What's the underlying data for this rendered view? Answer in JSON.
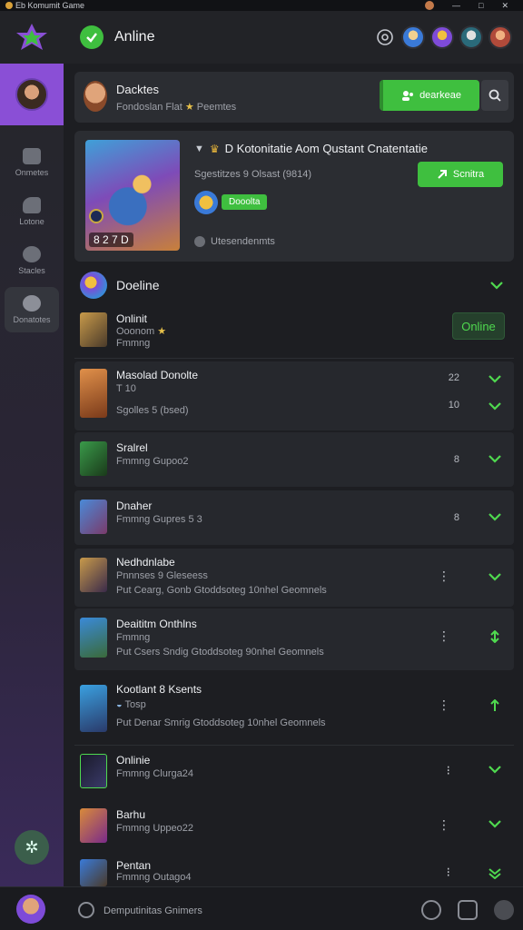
{
  "window": {
    "title": "Eb Komumit Game",
    "controls": [
      "—",
      "□",
      "✕"
    ]
  },
  "header": {
    "status_text": "Anline"
  },
  "sidebar": {
    "items": [
      {
        "label": "Onmetes",
        "icon": "store-icon"
      },
      {
        "label": "Lotone",
        "icon": "library-icon"
      },
      {
        "label": "Stacles",
        "icon": "friends-icon"
      },
      {
        "label": "Donatotes",
        "icon": "gear-icon"
      }
    ]
  },
  "profile": {
    "name": "Dacktes",
    "subtitle": "Fondoslan Flat",
    "status": "Peemtes",
    "add_button": "dearkeae"
  },
  "featured": {
    "title": "D Kotonitatie Aom Qustant Cnatentatie",
    "subtitle": "Sgestitzes 9 Olsast (9814)",
    "tag": "Dooolta",
    "button": "Scnitra",
    "version": "8 2 7 D",
    "footer": "Utesendenmts"
  },
  "section": {
    "title": "Doeline"
  },
  "rows": [
    {
      "title": "Onlinit",
      "line2": "Ooonom",
      "line3": "Fmmng",
      "pill": "Online"
    },
    {
      "title": "Masolad Donolte",
      "line2": "T 10",
      "line3": "Sgolles 5 (bsed)",
      "meta1": "22",
      "meta2": "10"
    },
    {
      "title": "Sralrel",
      "line2": "Fmmng  Gupoo2",
      "meta1": "8"
    },
    {
      "title": "Dnaher",
      "line2": "Fmmng  Gupres 5 3",
      "meta1": "8"
    },
    {
      "title": "Nedhdnlabe",
      "line2": "Pnnnses 9 Gleseess",
      "line3": "Put Cearg, Gonb  Gtoddsoteg 10nhel Geomnels"
    },
    {
      "title": "Deaititm Onthlns",
      "line2": "Fmmng",
      "line3": "Put Csers Sndig  Gtoddsoteg 90nhel Geomnels"
    },
    {
      "title": "Kootlant 8 Ksents",
      "line2": "Tosp",
      "line3": "Put Denar Smrig  Gtoddsoteg 10nhel Geomnels"
    },
    {
      "title": "Onlinie",
      "line2": "Fmmng  Clurga24"
    },
    {
      "title": "Barhu",
      "line2": "Fmmng  Uppeo22"
    },
    {
      "title": "Pentan",
      "line2": "Fmmng  Outago4"
    }
  ],
  "bottombar": {
    "text": "Demputinitas Gnimers"
  },
  "colors": {
    "accent": "#3fbf3f",
    "sidebar_active": "#8a4fd6",
    "panel": "#2b2d32",
    "bg": "#1d1e22"
  }
}
